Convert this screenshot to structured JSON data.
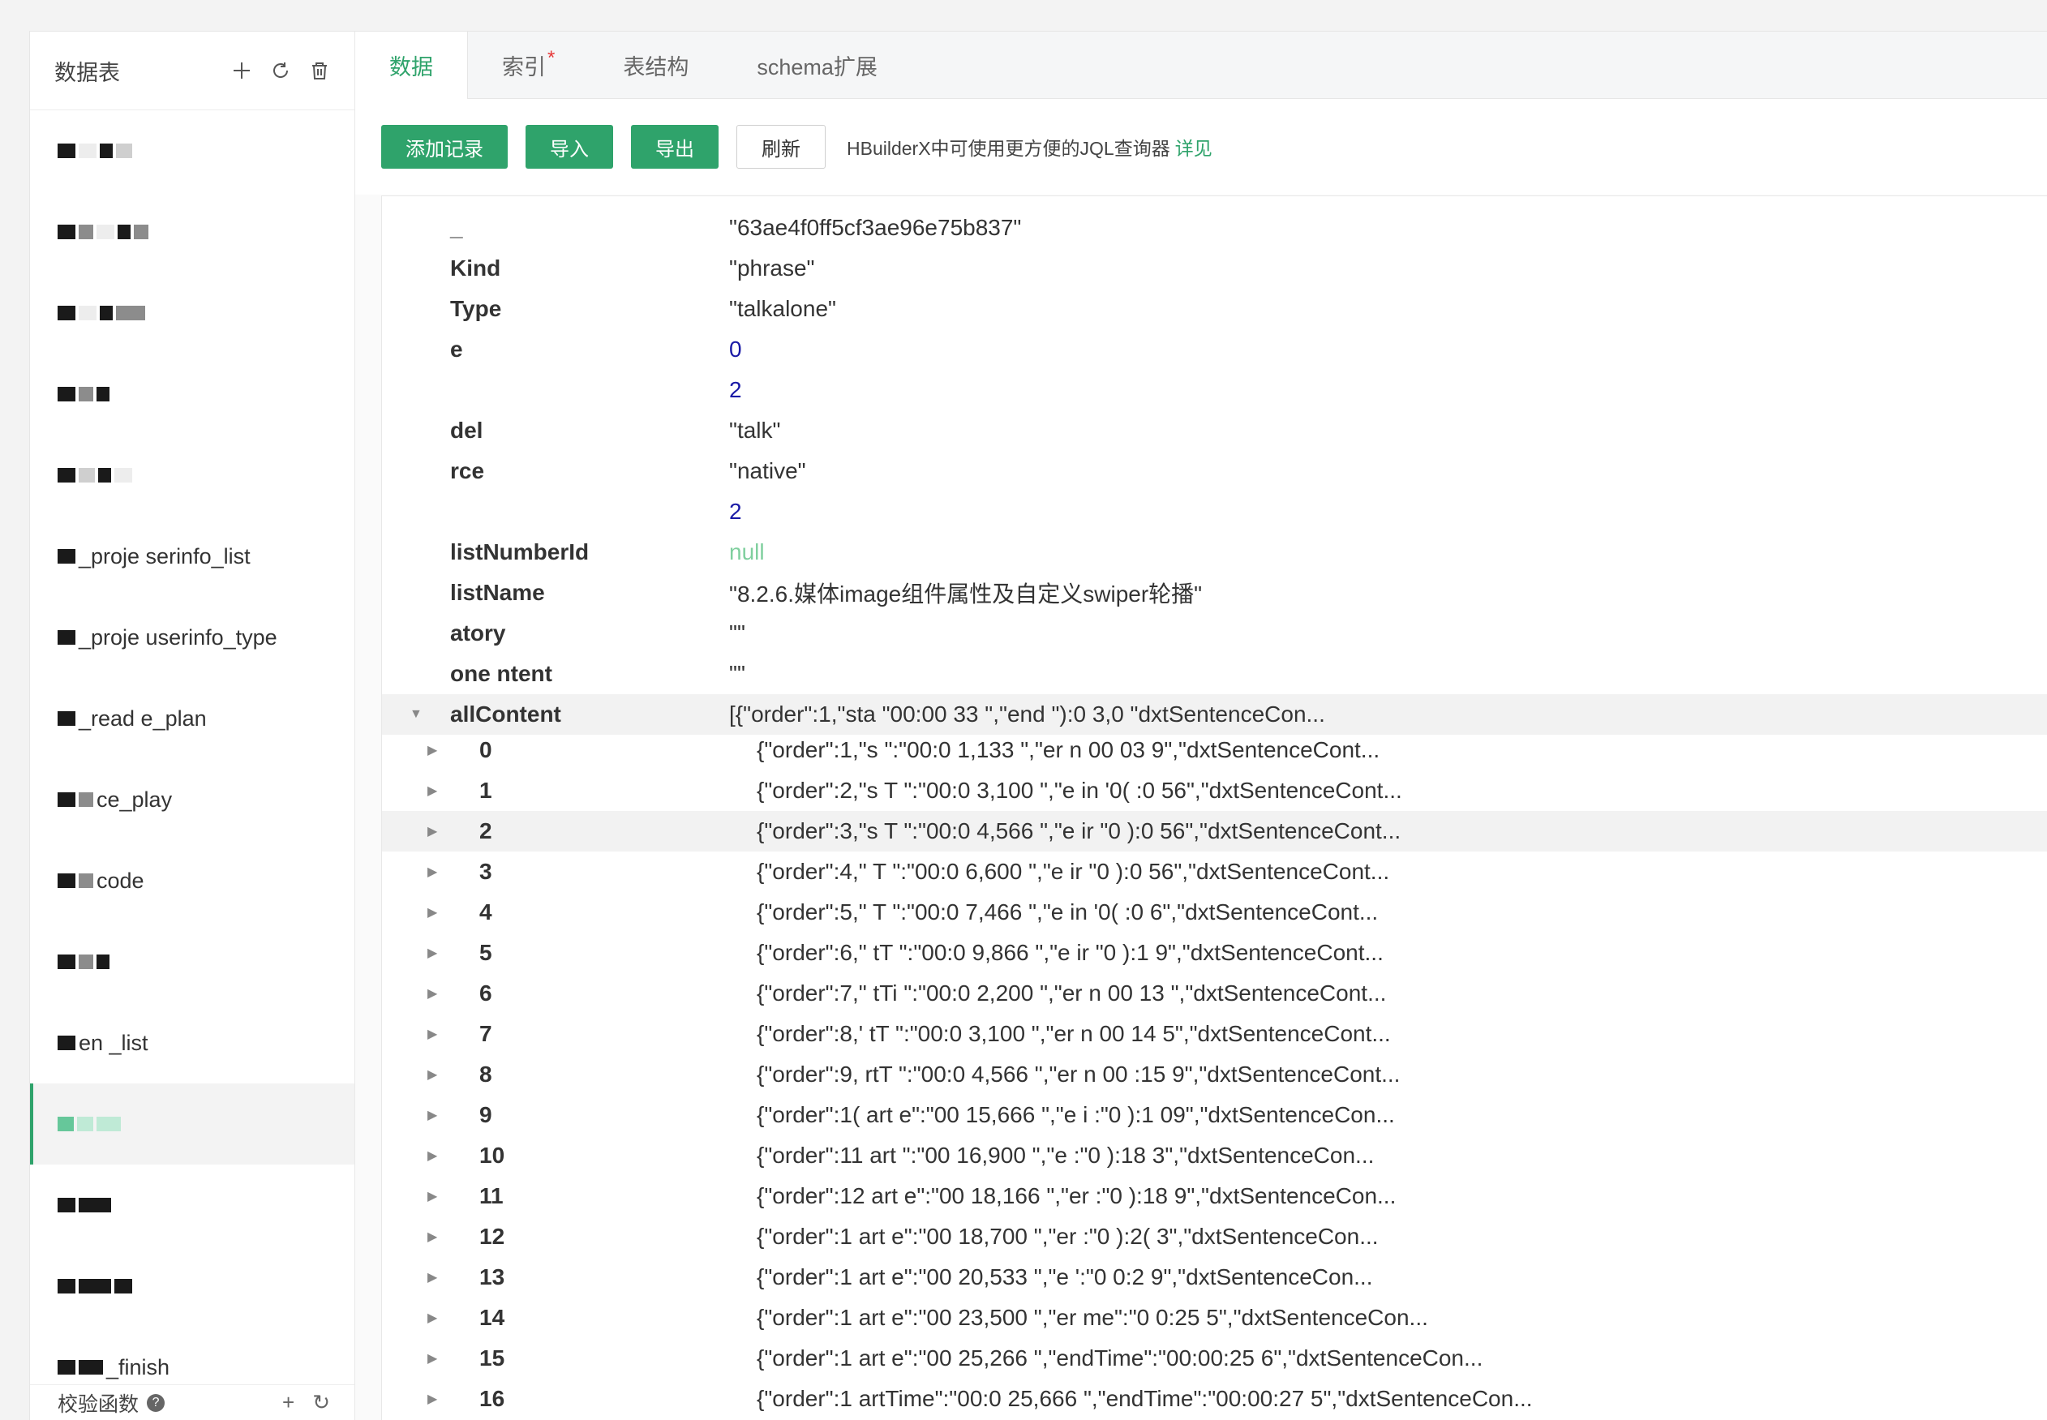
{
  "sidebar": {
    "title": "数据表",
    "items": [
      {
        "label": ""
      },
      {
        "label": ""
      },
      {
        "label": ""
      },
      {
        "label": ""
      },
      {
        "label": ""
      },
      {
        "label": "_proje   serinfo_list"
      },
      {
        "label": "_proje  userinfo_type"
      },
      {
        "label": "_read   e_plan"
      },
      {
        "label": "    ce_play"
      },
      {
        "label": "    code"
      },
      {
        "label": ""
      },
      {
        "label": "  en   _list"
      },
      {
        "label": ""
      },
      {
        "label": ""
      },
      {
        "label": ""
      },
      {
        "label": "   _finish"
      }
    ],
    "bottom_label": "校验函数",
    "bottom_help": "?"
  },
  "tabs": [
    {
      "label": "数据",
      "active": true
    },
    {
      "label": "索引",
      "star": "*"
    },
    {
      "label": "表结构"
    },
    {
      "label": "schema扩展"
    }
  ],
  "toolbar": {
    "add_label": "添加记录",
    "import_label": "导入",
    "export_label": "导出",
    "refresh_label": "刷新",
    "hint": "HBuilderX中可使用更方便的JQL查询器",
    "hint_link": "详见"
  },
  "record": {
    "fields": [
      {
        "key": "_",
        "value": "\"63ae4f0ff5cf3ae96e75b837\"",
        "type": "string"
      },
      {
        "key": "Kind",
        "value": "\"phrase\"",
        "type": "string"
      },
      {
        "key": "Type",
        "value": "\"talkalone\"",
        "type": "string"
      },
      {
        "key": "e",
        "value": "0",
        "type": "number"
      },
      {
        "key": "",
        "value": "2",
        "type": "number"
      },
      {
        "key": "del",
        "value": "\"talk\"",
        "type": "string"
      },
      {
        "key": "rce",
        "value": "\"native\"",
        "type": "string"
      },
      {
        "key": "",
        "value": "2",
        "type": "number"
      },
      {
        "key": "listNumberId",
        "value": "null",
        "type": "null"
      },
      {
        "key": "listName",
        "value": "\"8.2.6.媒体image组件属性及自定义swiper轮播\"",
        "type": "string"
      },
      {
        "key": "atory",
        "value": "\"\"",
        "type": "string"
      },
      {
        "key": "one  ntent",
        "value": "\"\"",
        "type": "string"
      }
    ],
    "array_field": {
      "key": "allContent",
      "value": "[{\"order\":1,\"sta    \"00:00    33 \",\"end     \"):0   3,0    \"dxtSentenceCon...",
      "items": [
        {
          "key": "0",
          "value": "{\"order\":1,\"s     \":\"00:0   1,133 \",\"er    n   00   03   9\",\"dxtSentenceCont..."
        },
        {
          "key": "1",
          "value": "{\"order\":2,\"s   T   \":\"00:0   3,100 \",\"e   in   '0(   :0   56\",\"dxtSentenceCont..."
        },
        {
          "key": "2",
          "value": "{\"order\":3,\"s   T   \":\"00:0   4,566 \",\"e   ir   \"0   ):0   56\",\"dxtSentenceCont..."
        },
        {
          "key": "3",
          "value": "{\"order\":4,\"   T   \":\"00:0   6,600 \",\"e   ir   \"0   ):0   56\",\"dxtSentenceCont..."
        },
        {
          "key": "4",
          "value": "{\"order\":5,\"   T   \":\"00:0   7,466 \",\"e   in   '0(   :0   6\",\"dxtSentenceCont..."
        },
        {
          "key": "5",
          "value": "{\"order\":6,\"   tT   \":\"00:0   9,866 \",\"e   ir   \"0   ):1   9\",\"dxtSentenceCont..."
        },
        {
          "key": "6",
          "value": "{\"order\":7,\"   tTi   \":\"00:0   2,200 \",\"er   n   00   13   \",\"dxtSentenceCont..."
        },
        {
          "key": "7",
          "value": "{\"order\":8,'   tT   \":\"00:0   3,100 \",\"er   n   00   14   5\",\"dxtSentenceCont..."
        },
        {
          "key": "8",
          "value": "{\"order\":9,   rtT   \":\"00:0   4,566 \",\"er   n   00   :15   9\",\"dxtSentenceCont..."
        },
        {
          "key": "9",
          "value": "{\"order\":1(   art   e\":\"00   15,666 \",\"e   i   :\"0   ):1   09\",\"dxtSentenceCon..."
        },
        {
          "key": "10",
          "value": "{\"order\":11   art   \":\"00   16,900 \",\"e   :\"0   ):18   3\",\"dxtSentenceCon..."
        },
        {
          "key": "11",
          "value": "{\"order\":12   art   e\":\"00   18,166 \",\"er   :\"0   ):18   9\",\"dxtSentenceCon..."
        },
        {
          "key": "12",
          "value": "{\"order\":1   art   e\":\"00   18,700 \",\"er   :\"0   ):2(   3\",\"dxtSentenceCon..."
        },
        {
          "key": "13",
          "value": "{\"order\":1   art   e\":\"00   20,533 \",\"e   ':\"0   0:2   9\",\"dxtSentenceCon..."
        },
        {
          "key": "14",
          "value": "{\"order\":1   art   e\":\"00   23,500 \",\"er   me\":\"0   0:25   5\",\"dxtSentenceCon..."
        },
        {
          "key": "15",
          "value": "{\"order\":1   art   e\":\"00   25,266 \",\"endTime\":\"00:00:25   6\",\"dxtSentenceCon..."
        },
        {
          "key": "16",
          "value": "{\"order\":1   artTime\":\"00:0   25,666 \",\"endTime\":\"00:00:27   5\",\"dxtSentenceCon..."
        }
      ]
    }
  }
}
